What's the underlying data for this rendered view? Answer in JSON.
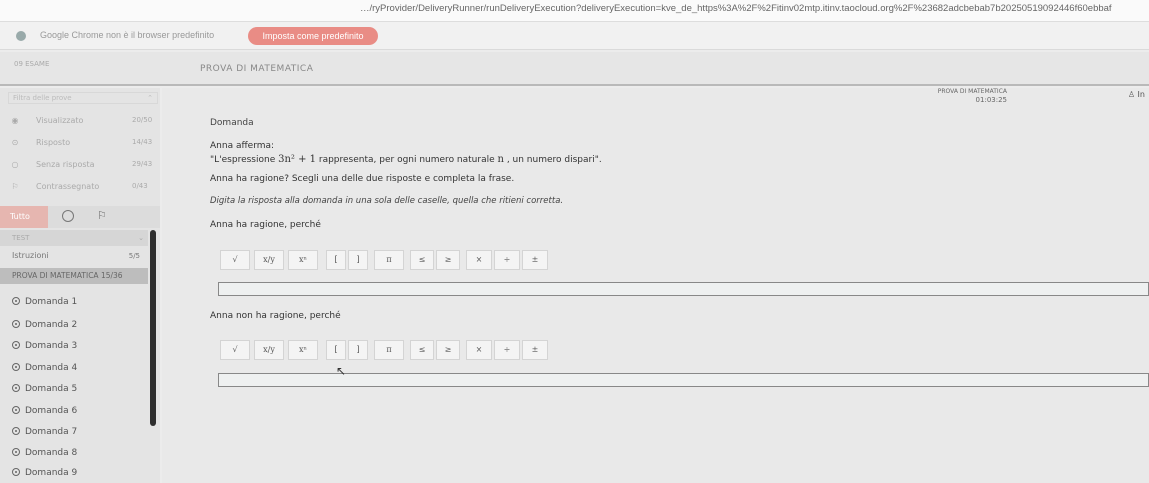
{
  "browser": {
    "url": "…/ryProvider/DeliveryRunner/runDeliveryExecution?deliveryExecution=kve_de_https%3A%2F%2Fitinv02mtp.itinv.taocloud.org%2F%23682adcbebab7b20250519092446f60ebbaf",
    "infobar_message": "Google Chrome non è il browser predefinito",
    "set_default_button": "Imposta come predefinito"
  },
  "exam": {
    "header_left": "09 ESAME",
    "title": "PROVA DI MATEMATICA",
    "timer_label": "PROVA DI MATEMATICA",
    "timer_value": "01:03:25",
    "user_label": "♙ In"
  },
  "sidebar": {
    "filter_placeholder": "Filtra delle prove",
    "stats": [
      {
        "icon": "eye-icon",
        "label": "Visualizzato",
        "count": "20/50"
      },
      {
        "icon": "check-circle-icon",
        "label": "Risposto",
        "count": "14/43"
      },
      {
        "icon": "circle-icon",
        "label": "Senza risposta",
        "count": "29/43"
      },
      {
        "icon": "flag-icon",
        "label": "Contrassegnato",
        "count": "0/43"
      }
    ],
    "filter_all": "Tutto",
    "test_header": "TEST",
    "instructions_label": "Istruzioni",
    "instructions_count": "5/5",
    "section_label": "PROVA DI MATEMATICA 15/36",
    "questions": [
      "Domanda 1",
      "Domanda 2",
      "Domanda 3",
      "Domanda 4",
      "Domanda 5",
      "Domanda 6",
      "Domanda 7",
      "Domanda 8",
      "Domanda 9"
    ]
  },
  "question": {
    "label": "Domanda",
    "intro": "Anna afferma:",
    "statement_pre": "\"L'espressione ",
    "statement_math": "3n² + 1",
    "statement_mid": " rappresenta, per ogni numero naturale ",
    "statement_var": "n",
    "statement_post": " , un numero dispari\".",
    "ask": "Anna ha ragione? Scegli una delle due risposte e completa la frase.",
    "instructions": "Digita la risposta alla domanda in una sola delle caselle, quella che ritieni corretta.",
    "part1_label": "Anna ha ragione, perché",
    "part2_label": "Anna non ha ragione, perché"
  },
  "math_tools": [
    "√",
    "x/y",
    "xⁿ",
    "[",
    "]",
    "π",
    "≤",
    "≥",
    "×",
    "÷",
    "±"
  ]
}
